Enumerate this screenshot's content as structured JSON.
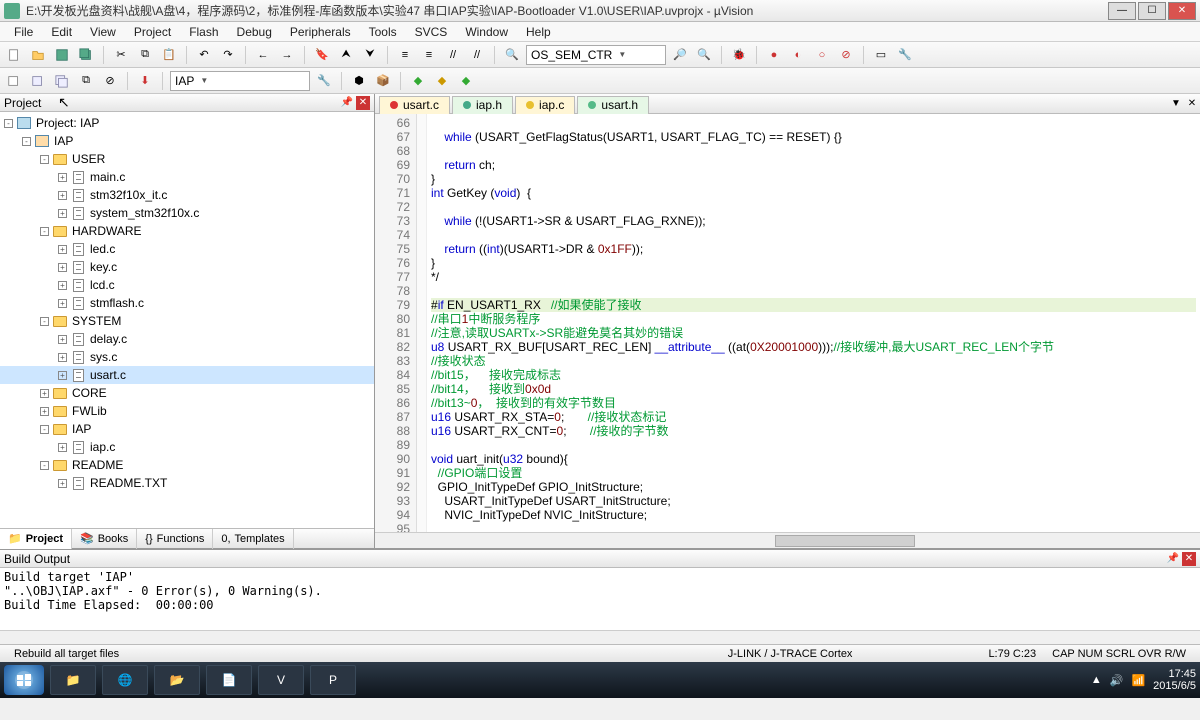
{
  "window": {
    "title": "E:\\开发板光盘资料\\战舰\\A盘\\4，程序源码\\2，标准例程-库函数版本\\实验47 串口IAP实验\\IAP-Bootloader V1.0\\USER\\IAP.uvprojx - µVision"
  },
  "menu": [
    "File",
    "Edit",
    "View",
    "Project",
    "Flash",
    "Debug",
    "Peripherals",
    "Tools",
    "SVCS",
    "Window",
    "Help"
  ],
  "toolbar1": {
    "combo": "OS_SEM_CTR"
  },
  "toolbar2": {
    "target": "IAP"
  },
  "project": {
    "pane_title": "Project",
    "root": "Project: IAP",
    "target": "IAP",
    "groups": [
      {
        "name": "USER",
        "files": [
          "main.c",
          "stm32f10x_it.c",
          "system_stm32f10x.c"
        ]
      },
      {
        "name": "HARDWARE",
        "files": [
          "led.c",
          "key.c",
          "lcd.c",
          "stmflash.c"
        ]
      },
      {
        "name": "SYSTEM",
        "files": [
          "delay.c",
          "sys.c",
          "usart.c"
        ]
      },
      {
        "name": "CORE",
        "files": []
      },
      {
        "name": "FWLib",
        "files": []
      },
      {
        "name": "IAP",
        "files": [
          "iap.c"
        ]
      },
      {
        "name": "README",
        "files": [
          "README.TXT"
        ]
      }
    ],
    "tabs": [
      "Project",
      "Books",
      "Functions",
      "Templates"
    ],
    "active_tab": "Project",
    "selected": "usart.c"
  },
  "editor": {
    "tabs": [
      {
        "name": "usart.c",
        "kind": "c",
        "active": true
      },
      {
        "name": "iap.h",
        "kind": "h"
      },
      {
        "name": "iap.c",
        "kind": "c"
      },
      {
        "name": "usart.h",
        "kind": "h"
      }
    ],
    "first_line": 66,
    "lines": [
      "",
      "    while (USART_GetFlagStatus(USART1, USART_FLAG_TC) == RESET) {}",
      "",
      "    return ch;",
      "}",
      "int GetKey (void)  {",
      "",
      "    while (!(USART1->SR & USART_FLAG_RXNE));",
      "",
      "    return ((int)(USART1->DR & 0x1FF));",
      "}",
      "*/",
      "",
      "#if EN_USART1_RX   //如果使能了接收",
      "//串口1中断服务程序",
      "//注意,读取USARTx->SR能避免莫名其妙的错误",
      "u8 USART_RX_BUF[USART_REC_LEN] __attribute__ ((at(0X20001000)));//接收缓冲,最大USART_REC_LEN个字节",
      "//接收状态",
      "//bit15，    接收完成标志",
      "//bit14，    接收到0x0d",
      "//bit13~0，  接收到的有效字节数目",
      "u16 USART_RX_STA=0;       //接收状态标记",
      "u16 USART_RX_CNT=0;       //接收的字节数",
      "",
      "void uart_init(u32 bound){",
      "  //GPIO端口设置",
      "  GPIO_InitTypeDef GPIO_InitStructure;",
      "    USART_InitTypeDef USART_InitStructure;",
      "    NVIC_InitTypeDef NVIC_InitStructure;",
      ""
    ],
    "highlight_index": 13
  },
  "build": {
    "title": "Build Output",
    "lines": [
      "Build target 'IAP'",
      "\"..\\OBJ\\IAP.axf\" - 0 Error(s), 0 Warning(s).",
      "Build Time Elapsed:  00:00:00"
    ]
  },
  "status": {
    "left": "Rebuild all target files",
    "mid": "J-LINK / J-TRACE Cortex",
    "pos": "L:79 C:23",
    "indicators": "CAP  NUM  SCRL  OVR  R/W"
  },
  "taskbar": {
    "time": "17:45",
    "date": "2015/6/5"
  }
}
